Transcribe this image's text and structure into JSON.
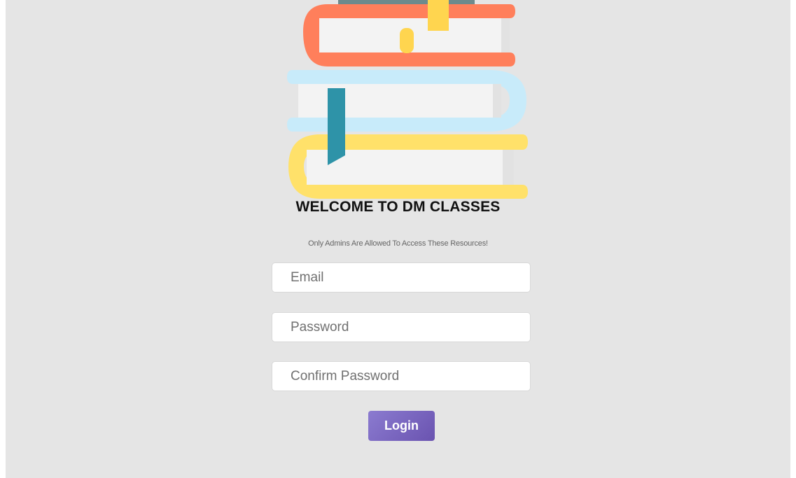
{
  "header": {
    "title": "WELCOME TO DM CLASSES",
    "subtitle": "Only Admins Are Allowed To Access These Resources!"
  },
  "illustration": {
    "icon": "stacked-books-icon",
    "colors": {
      "top_book": "#ff7f5b",
      "middle_book": "#c8ebfa",
      "bottom_book": "#ffe16a",
      "pages": "#f3f3f3",
      "bookmark_yellow": "#ffd54f",
      "bookmark_teal": "#2e93a8"
    }
  },
  "form": {
    "email": {
      "placeholder": "Email",
      "value": ""
    },
    "password": {
      "placeholder": "Password",
      "value": ""
    },
    "confirm_password": {
      "placeholder": "Confirm Password",
      "value": ""
    },
    "login_label": "Login"
  },
  "colors": {
    "background": "#e5e5e5",
    "button": "#7562bf"
  }
}
